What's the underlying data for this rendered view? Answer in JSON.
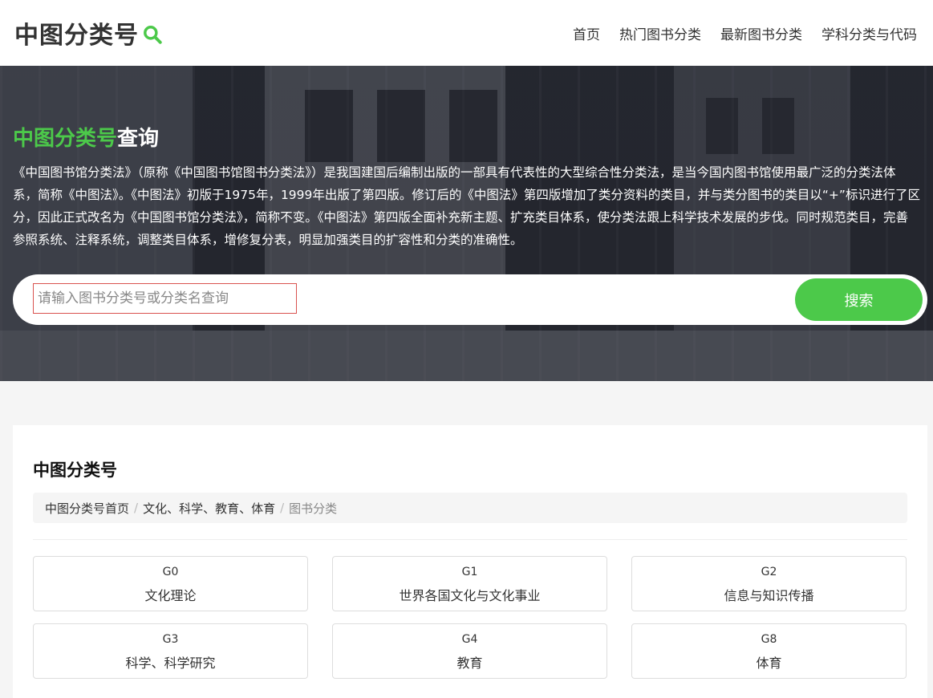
{
  "header": {
    "logo_text": "中图分类号",
    "nav": [
      "首页",
      "热门图书分类",
      "最新图书分类",
      "学科分类与代码"
    ]
  },
  "hero": {
    "title_green": "中图分类号",
    "title_white": "查询",
    "description": "《中国图书馆分类法》（原称《中国图书馆图书分类法》）是我国建国后编制出版的一部具有代表性的大型综合性分类法，是当今国内图书馆使用最广泛的分类法体系，简称《中图法》。《中图法》初版于1975年，1999年出版了第四版。修订后的《中图法》第四版增加了类分资料的类目，并与类分图书的类目以“+”标识进行了区分，因此正式改名为《中国图书馆分类法》，简称不变。《中图法》第四版全面补充新主题、扩充类目体系，使分类法跟上科学技术发展的步伐。同时规范类目，完善参照系统、注释系统，调整类目体系，增修复分表，明显加强类目的扩容性和分类的准确性。",
    "search_placeholder": "请输入图书分类号或分类名查询",
    "search_button": "搜索"
  },
  "main": {
    "title": "中图分类号",
    "breadcrumb": [
      "中图分类号首页",
      "文化、科学、教育、体育",
      "图书分类"
    ],
    "categories": [
      {
        "code": "G0",
        "name": "文化理论"
      },
      {
        "code": "G1",
        "name": "世界各国文化与文化事业"
      },
      {
        "code": "G2",
        "name": "信息与知识传播"
      },
      {
        "code": "G3",
        "name": "科学、科学研究"
      },
      {
        "code": "G4",
        "name": "教育"
      },
      {
        "code": "G8",
        "name": "体育"
      }
    ]
  },
  "colors": {
    "accent": "#4cc94a",
    "input_border": "#d9534f"
  }
}
